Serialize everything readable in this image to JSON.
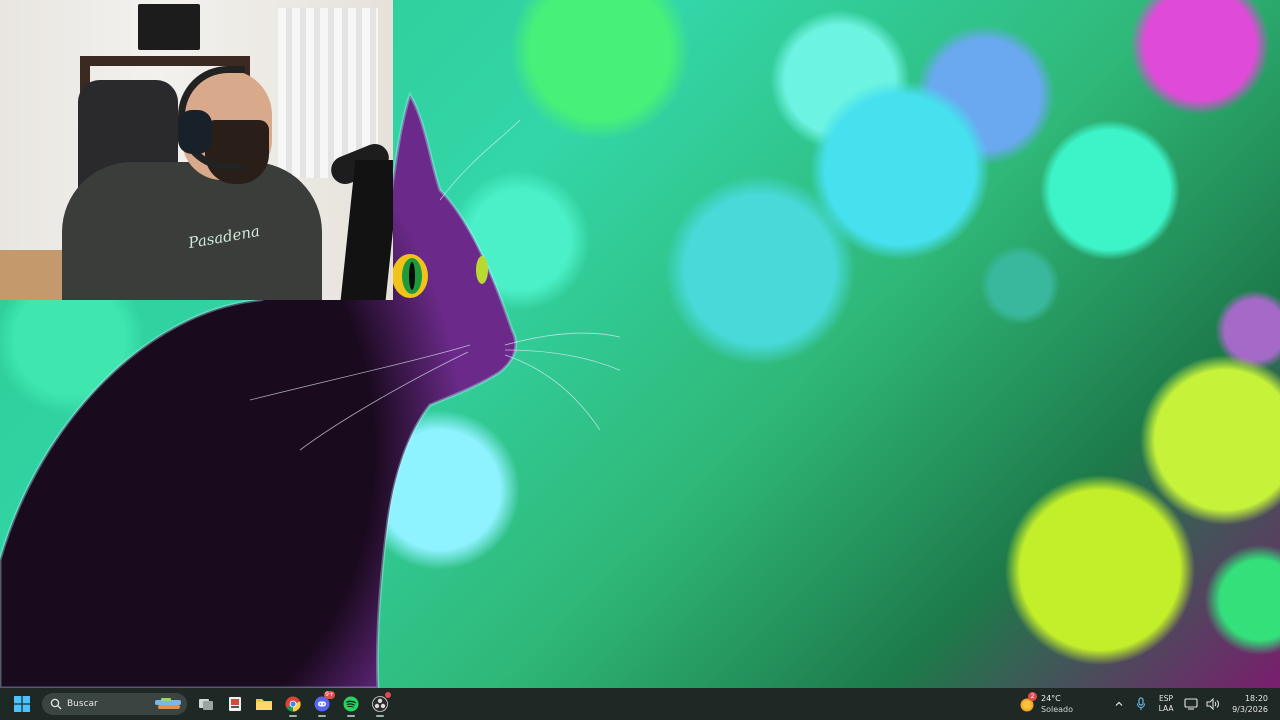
{
  "taskbar": {
    "search": {
      "label": "Buscar"
    },
    "apps": [
      {
        "name": "task-view",
        "icon": "task-view-icon"
      },
      {
        "name": "widget-app",
        "icon": "app-icon"
      },
      {
        "name": "file-explorer",
        "icon": "folder-icon"
      },
      {
        "name": "chrome",
        "icon": "chrome-icon"
      },
      {
        "name": "discord",
        "icon": "discord-icon",
        "badge": "9+"
      },
      {
        "name": "spotify",
        "icon": "spotify-icon"
      },
      {
        "name": "obs",
        "icon": "obs-icon"
      }
    ],
    "weather": {
      "badge": "2",
      "temp": "24°C",
      "condition": "Soleado"
    },
    "tray": {
      "lang_top": "ESP",
      "lang_bottom": "LAA",
      "time": "18:20",
      "date": "9/3/2026"
    }
  },
  "webcam": {
    "shirt_text": "Pasadena"
  },
  "colors": {
    "taskbar_bg": "#1e2824",
    "accent": "#1e90ff"
  }
}
